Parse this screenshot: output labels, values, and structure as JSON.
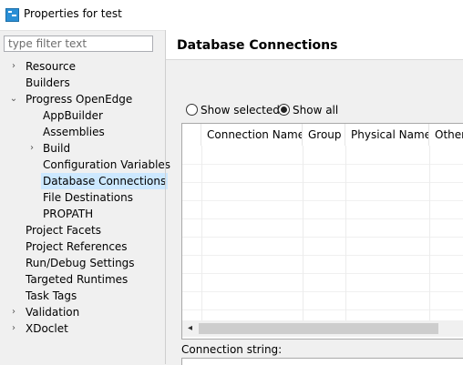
{
  "window": {
    "title": "Properties for test"
  },
  "filter": {
    "placeholder": "type filter text",
    "value": ""
  },
  "tree": {
    "resource": "Resource",
    "builders": "Builders",
    "progress_openedge": "Progress OpenEdge",
    "appbuilder": "AppBuilder",
    "assemblies": "Assemblies",
    "build": "Build",
    "configuration_variables": "Configuration Variables",
    "database_connections": "Database Connections",
    "file_destinations": "File Destinations",
    "propath": "PROPATH",
    "project_facets": "Project Facets",
    "project_references": "Project References",
    "run_debug_settings": "Run/Debug Settings",
    "targeted_runtimes": "Targeted Runtimes",
    "task_tags": "Task Tags",
    "validation": "Validation",
    "xdoclet": "XDoclet"
  },
  "panel": {
    "title": "Database Connections",
    "show_selected": "Show selected",
    "show_all": "Show all",
    "selected_view": "Show all",
    "columns": {
      "connection_name": "Connection Name",
      "group": "Group",
      "physical_name": "Physical Name",
      "other": "Other"
    },
    "connection_string_label": "Connection string:",
    "connection_string_value": ""
  },
  "colors": {
    "selection": "#cce8ff",
    "background": "#f0f0f0",
    "app_icon": "#2a8fd6"
  },
  "icons": [
    "app-icon",
    "chevron-right-icon",
    "chevron-down-icon",
    "scroll-left-arrow-icon"
  ]
}
